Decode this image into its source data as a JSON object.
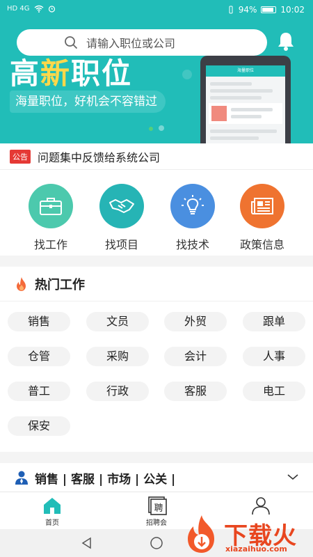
{
  "status_bar": {
    "left_icons": "HD 4G",
    "battery": "94%",
    "time": "10:02"
  },
  "search": {
    "placeholder": "请输入职位或公司"
  },
  "banner": {
    "title_pre": "高",
    "title_accent": "新",
    "title_post": "职位",
    "subtitle": "海量职位，好机会不容错过",
    "mock_screen_title": "海量职位"
  },
  "notice": {
    "badge": "公告",
    "text": "问题集中反馈给系统公司"
  },
  "quick_entries": [
    {
      "label": "找工作",
      "icon": "briefcase-icon",
      "color": "#4cc9ad"
    },
    {
      "label": "找项目",
      "icon": "handshake-icon",
      "color": "#26b4b5"
    },
    {
      "label": "找技术",
      "icon": "lightbulb-icon",
      "color": "#4a8fe0"
    },
    {
      "label": "政策信息",
      "icon": "newspaper-icon",
      "color": "#ef7330"
    }
  ],
  "hot_jobs": {
    "title": "热门工作",
    "tags": [
      "销售",
      "文员",
      "外贸",
      "跟单",
      "仓管",
      "采购",
      "会计",
      "人事",
      "普工",
      "行政",
      "客服",
      "电工",
      "保安"
    ]
  },
  "category": {
    "text": "销售 | 客服 | 市场 | 公关 |"
  },
  "tabbar": {
    "tabs": [
      {
        "label": "首页",
        "active": true
      },
      {
        "label": "招聘会",
        "active": false
      },
      {
        "label": "",
        "active": false
      }
    ],
    "job_fair_glyph": "聘"
  },
  "watermark": {
    "text": "下载火",
    "domain": "xiazaihuo.com"
  },
  "colors": {
    "brand_teal": "#21bdb8",
    "accent_yellow": "#ffd84a",
    "notice_red": "#e53935"
  }
}
